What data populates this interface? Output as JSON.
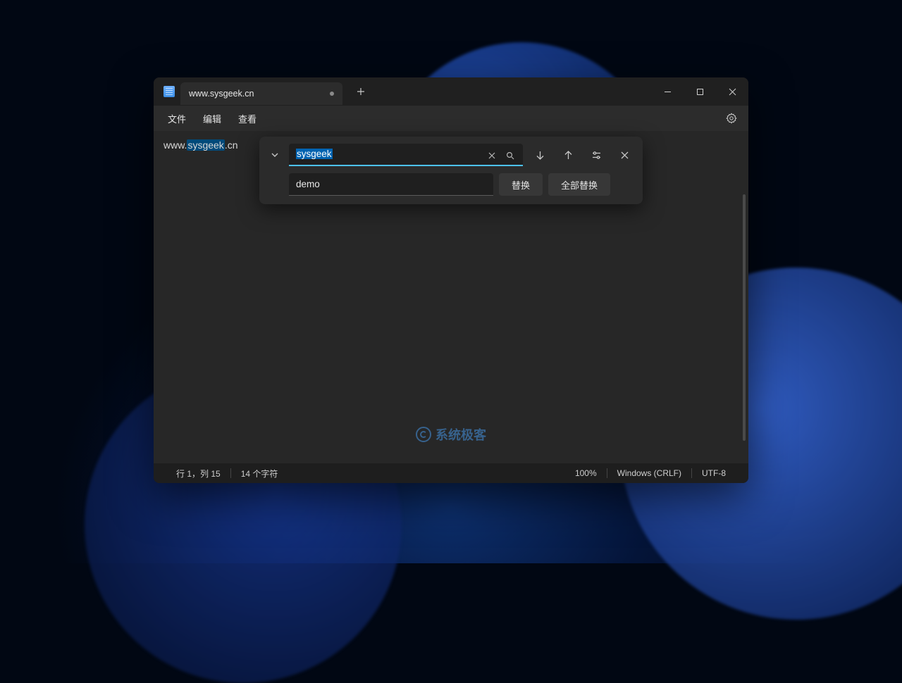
{
  "tab": {
    "title": "www.sysgeek.cn"
  },
  "menu": {
    "file": "文件",
    "edit": "编辑",
    "view": "查看"
  },
  "editor": {
    "prefix": "www.",
    "highlight": "sysgeek",
    "suffix": ".cn"
  },
  "find": {
    "search_value": "sysgeek",
    "replace_value": "demo",
    "replace_button": "替换",
    "replace_all_button": "全部替换"
  },
  "status": {
    "position": "行 1，列 15",
    "chars": "14 个字符",
    "zoom": "100%",
    "line_ending": "Windows (CRLF)",
    "encoding": "UTF-8"
  },
  "watermark": "系统极客"
}
